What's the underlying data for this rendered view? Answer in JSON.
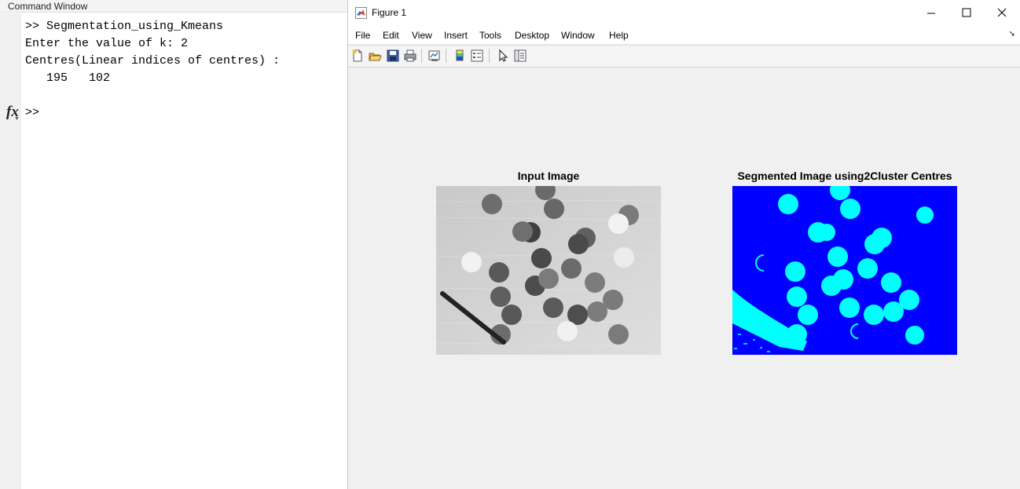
{
  "command_window": {
    "title": "Command Window",
    "lines": [
      ">> Segmentation_using_Kmeans",
      "Enter the value of k: 2",
      "Centres(Linear indices of centres) :",
      "   195   102"
    ],
    "prompt": ">>",
    "fx_label": "fx"
  },
  "figure": {
    "title": "Figure 1",
    "menu": [
      "File",
      "Edit",
      "View",
      "Insert",
      "Tools",
      "Desktop",
      "Window",
      "Help"
    ],
    "toolbar": [
      "new-figure-icon",
      "open-file-icon",
      "save-icon",
      "print-icon",
      "link-plot-icon",
      "insert-colorbar-icon",
      "insert-legend-icon",
      "edit-plot-icon",
      "property-inspector-icon"
    ],
    "axes": [
      {
        "title": "Input Image"
      },
      {
        "title": "Segmented Image using2Cluster Centres"
      }
    ]
  },
  "colors": {
    "segmented_background": "#0000ff",
    "segmented_foreground": "#00ffff"
  }
}
